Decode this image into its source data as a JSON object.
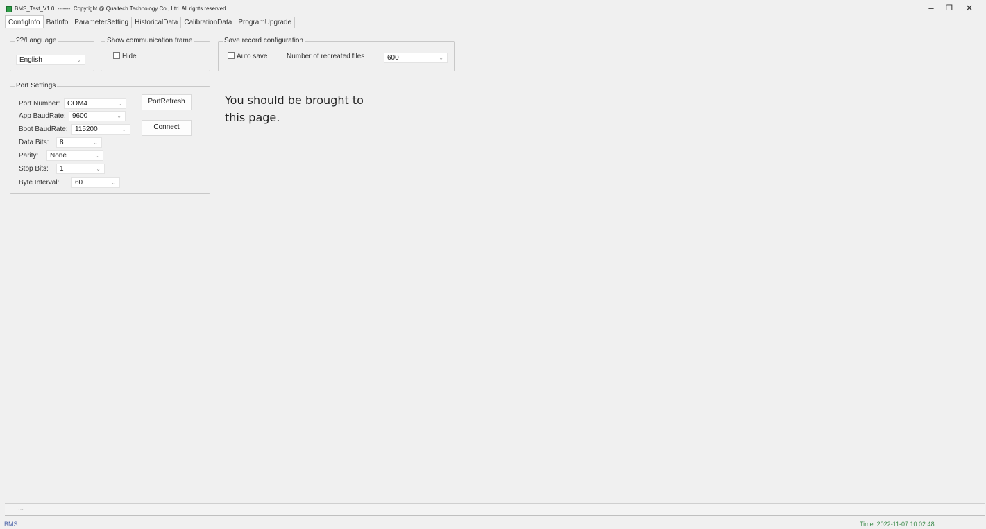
{
  "window": {
    "title": "BMS_Test_V1.0  -------  Copyright @ Qualtech Technology Co., Ltd. All rights reserved",
    "minimize_symbol": "–",
    "maximize_symbol": "❐",
    "close_symbol": "✕"
  },
  "tabs": [
    {
      "label": "ConfigInfo",
      "active": true
    },
    {
      "label": "BatInfo"
    },
    {
      "label": "ParameterSetting"
    },
    {
      "label": "HistoricalData"
    },
    {
      "label": "CalibrationData"
    },
    {
      "label": "ProgramUpgrade"
    }
  ],
  "language": {
    "legend": "??/Language",
    "value": "English"
  },
  "comm_frame": {
    "legend": "Show communication frame",
    "hide_label": "Hide",
    "hide_checked": false
  },
  "save_record": {
    "legend": "Save record configuration",
    "auto_save_label": "Auto save",
    "auto_save_checked": false,
    "files_label": "Number of recreated files",
    "files_value": "600"
  },
  "port_settings": {
    "legend": "Port Settings",
    "port_number_label": "Port Number:",
    "port_number_value": "COM4",
    "app_baud_label": "App BaudRate:",
    "app_baud_value": "9600",
    "boot_baud_label": "Boot BaudRate:",
    "boot_baud_value": "115200",
    "data_bits_label": "Data Bits:",
    "data_bits_value": "8",
    "parity_label": "Parity:",
    "parity_value": "None",
    "stop_bits_label": "Stop Bits:",
    "stop_bits_value": "1",
    "byte_interval_label": "Byte Interval:",
    "byte_interval_value": "60",
    "port_refresh_button": "PortRefresh",
    "connect_button": "Connect"
  },
  "callout": {
    "line1": "You should be brought to",
    "line2": "this page."
  },
  "statusbar": {
    "left": "BMS",
    "time": "Time: 2022-11-07 10:02:48"
  },
  "icons": {
    "chevron": "⌄",
    "app_icon": "app-icon"
  },
  "colors": {
    "app_icon": "#2e9e47",
    "status_left": "#4a63a8",
    "status_time": "#3a8a4a"
  }
}
